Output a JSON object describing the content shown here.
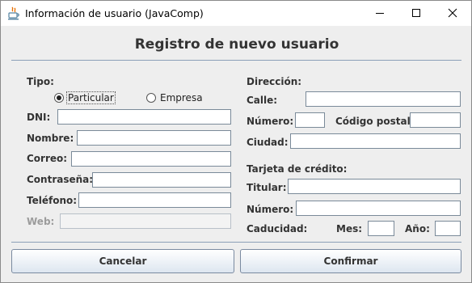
{
  "window": {
    "title": "Información de usuario (JavaComp)"
  },
  "form": {
    "heading": "Registro de nuevo usuario",
    "left": {
      "tipo_label": "Tipo:",
      "radio_particular": "Particular",
      "radio_empresa": "Empresa",
      "selected_tipo": "Particular",
      "dni_label": "DNI:",
      "dni_value": "",
      "nombre_label": "Nombre:",
      "nombre_value": "",
      "correo_label": "Correo:",
      "correo_value": "",
      "contrasena_label": "Contraseña:",
      "contrasena_value": "",
      "telefono_label": "Teléfono:",
      "telefono_value": "",
      "web_label": "Web:",
      "web_value": ""
    },
    "right": {
      "direccion_label": "Dirección:",
      "calle_label": "Calle:",
      "calle_value": "",
      "numero_label": "Número:",
      "numero_value": "",
      "codigo_postal_label": "Código postal:",
      "codigo_postal_value": "",
      "ciudad_label": "Ciudad:",
      "ciudad_value": "",
      "tarjeta_label": "Tarjeta de crédito:",
      "titular_label": "Titular:",
      "titular_value": "",
      "tarjeta_numero_label": "Número:",
      "tarjeta_numero_value": "",
      "caducidad_label": "Caducidad:",
      "mes_label": "Mes:",
      "mes_value": "",
      "anio_label": "Año:",
      "anio_value": ""
    }
  },
  "buttons": {
    "cancel": "Cancelar",
    "confirm": "Confirmar"
  }
}
